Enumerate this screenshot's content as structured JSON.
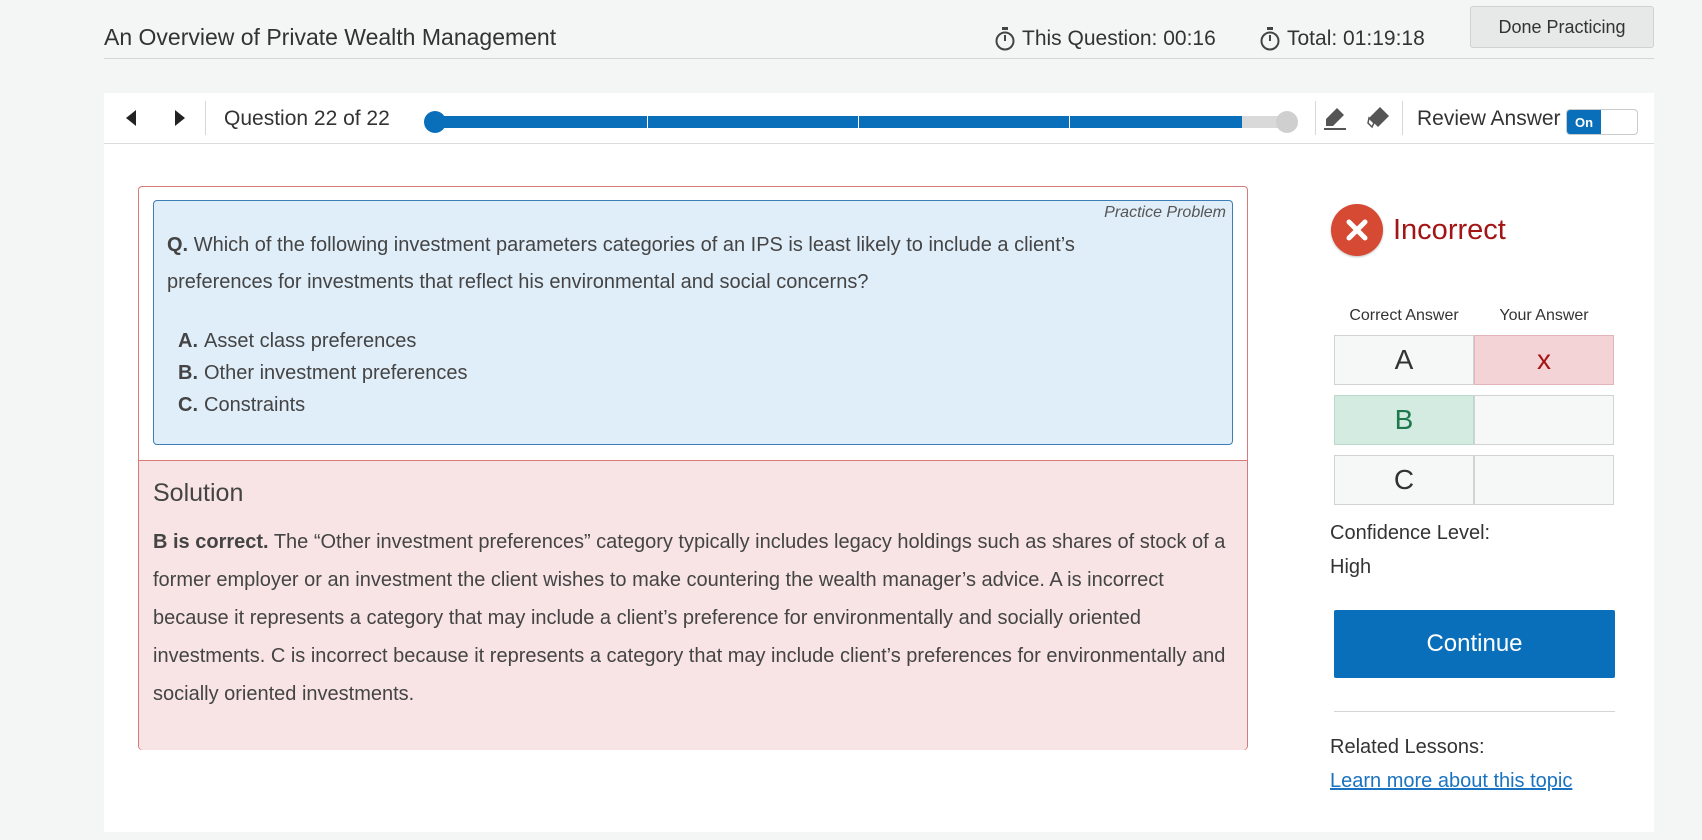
{
  "header": {
    "title": "An Overview of Private Wealth Management",
    "this_question": "This Question: 00:16",
    "total": "Total: 01:19:18",
    "done_button": "Done Practicing"
  },
  "nav": {
    "question_counter": "Question 22 of 22",
    "progress_fraction": 0.94,
    "review_label": "Review Answer",
    "review_toggle": "On"
  },
  "question": {
    "tag": "Practice Problem",
    "prefix": "Q.",
    "text": "Which of the following investment parameters categories of an IPS is least likely to include a client’s preferences for investments that reflect his environmental and social concerns?",
    "choices": [
      {
        "letter": "A.",
        "text": "Asset class preferences"
      },
      {
        "letter": "B.",
        "text": "Other investment preferences"
      },
      {
        "letter": "C.",
        "text": "Constraints"
      }
    ]
  },
  "solution": {
    "title": "Solution",
    "lead": "B is correct.",
    "text": "The “Other investment preferences” category typically includes legacy holdings such as shares of stock of a former employer or an investment the client wishes to make countering the wealth manager’s advice. A is incorrect because it represents a category that may include a client’s preference for environmentally and socially oriented investments. C is incorrect because it represents a category that may include client’s preferences for environmentally and socially oriented investments."
  },
  "result": {
    "status": "Incorrect",
    "col_correct": "Correct Answer",
    "col_yours": "Your Answer",
    "rows": [
      {
        "letter": "A",
        "yours": "x"
      },
      {
        "letter": "B",
        "yours": ""
      },
      {
        "letter": "C",
        "yours": ""
      }
    ],
    "confidence_label": "Confidence Level:",
    "confidence_value": "High",
    "continue": "Continue",
    "related_label": "Related Lessons:",
    "related_link": "Learn more about this topic"
  },
  "colors": {
    "accent": "#0a6fba",
    "incorrect": "#a31414",
    "correct_cell": "#d3ebe1",
    "wrong_cell": "#f4d3d6"
  }
}
